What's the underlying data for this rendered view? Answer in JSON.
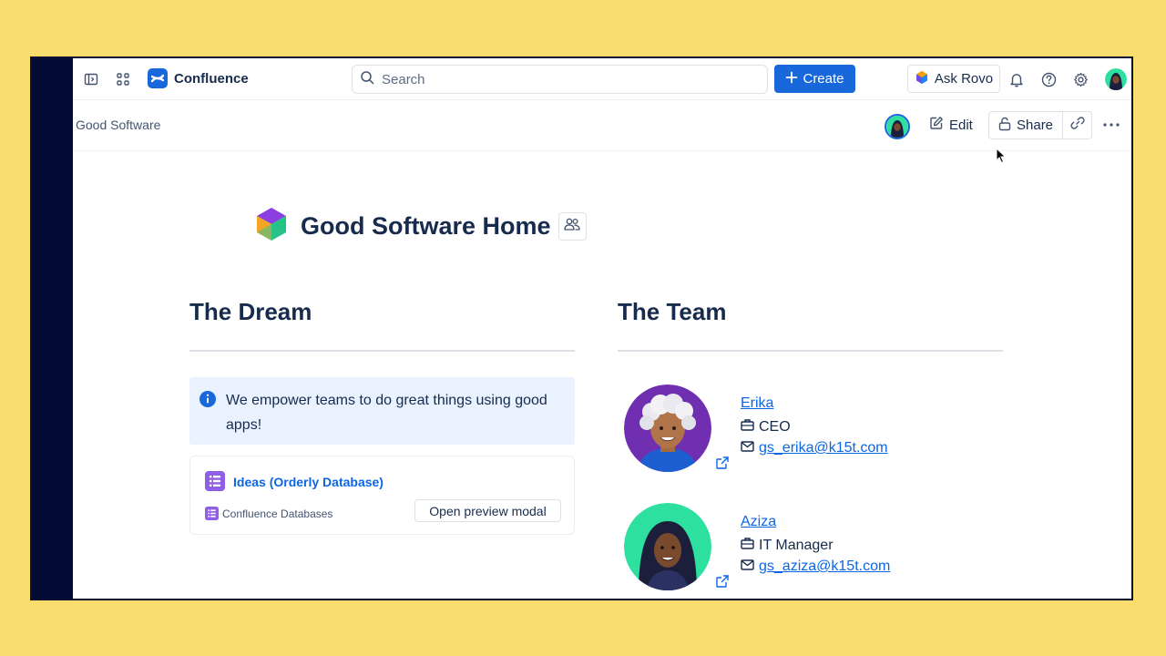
{
  "nav": {
    "brand": "Confluence",
    "search_placeholder": "Search",
    "create_label": "Create",
    "ask_rovo_label": "Ask Rovo"
  },
  "toolbar": {
    "breadcrumb": "Good Software",
    "edit_label": "Edit",
    "share_label": "Share"
  },
  "page": {
    "title": "Good Software Home"
  },
  "dream": {
    "heading": "The Dream",
    "info_panel_text": "We empower teams to do great things using good apps!",
    "database": {
      "title": "Ideas (Orderly Database)",
      "source": "Confluence Databases",
      "preview_label": "Open preview modal"
    }
  },
  "team": {
    "heading": "The Team",
    "members": [
      {
        "name": "Erika",
        "role": "CEO",
        "email": "gs_erika@k15t.com"
      },
      {
        "name": "Aziza",
        "role": "IT Manager",
        "email": "gs_aziza@k15t.com"
      }
    ]
  },
  "colors": {
    "background": "#f9dd6e",
    "left_rail": "#030a33",
    "primary": "#1868db",
    "link": "#0c66e4",
    "info_panel": "#e9f2fe",
    "erika_avatar_bg": "#6f2fb0",
    "aziza_avatar_bg": "#2ee0a0"
  },
  "icons": [
    "sidebar-toggle-icon",
    "app-switcher-icon",
    "confluence-logo-icon",
    "search-icon",
    "plus-icon",
    "rovo-icon",
    "bell-icon",
    "help-icon",
    "gear-icon",
    "edit-icon",
    "lock-icon",
    "link-icon",
    "more-icon",
    "page-emoji-icon",
    "people-icon",
    "info-icon",
    "database-icon",
    "external-link-icon",
    "briefcase-icon",
    "mail-icon",
    "cursor-icon"
  ]
}
